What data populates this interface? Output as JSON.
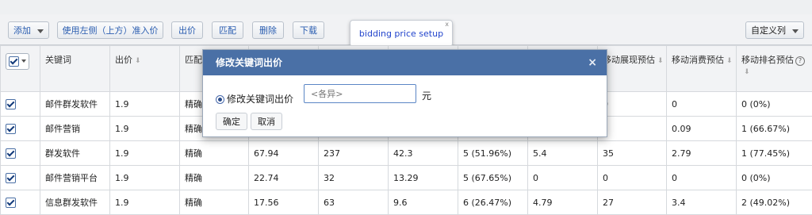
{
  "toolbar": {
    "add_label": "添加",
    "use_left_label": "使用左侧（上方）准入价",
    "bid_label": "出价",
    "match_label": "匹配",
    "delete_label": "删除",
    "download_label": "下载",
    "custom_columns_label": "自定义列"
  },
  "tooltip": {
    "text": "bidding price setup",
    "close": "x"
  },
  "table": {
    "headers": [
      "关键词",
      "出价",
      "匹配",
      "",
      "",
      "",
      "",
      "移动展现预估",
      "移动消费预估",
      "移动排名预估"
    ],
    "rows": [
      {
        "checked": true,
        "cells": [
          "邮件群发软件",
          "1.9",
          "精确",
          "",
          "",
          "",
          "",
          "0",
          "0",
          "0 (0%)"
        ]
      },
      {
        "checked": true,
        "cells": [
          "邮件营销",
          "1.9",
          "精确",
          "",
          "",
          "",
          "",
          "2",
          "0.09",
          "1 (66.67%)"
        ]
      },
      {
        "checked": true,
        "cells": [
          "群发软件",
          "1.9",
          "精确",
          "67.94",
          "237",
          "42.3",
          "5 (51.96%)",
          "5.4",
          "35",
          "2.79",
          "1 (77.45%)"
        ]
      },
      {
        "checked": true,
        "cells": [
          "邮件营销平台",
          "1.9",
          "精确",
          "22.74",
          "32",
          "13.29",
          "5 (67.65%)",
          "0",
          "0",
          "0",
          "0 (0%)"
        ]
      },
      {
        "checked": true,
        "cells": [
          "信息群发软件",
          "1.9",
          "精确",
          "17.56",
          "63",
          "9.6",
          "6 (26.47%)",
          "4.79",
          "27",
          "3.4",
          "2 (49.02%)"
        ]
      }
    ]
  },
  "dialog": {
    "title": "修改关键词出价",
    "close": "×",
    "option_label": "修改关键词出价",
    "input_placeholder": "<各异>",
    "unit": "元",
    "confirm_label": "确定",
    "cancel_label": "取消"
  }
}
